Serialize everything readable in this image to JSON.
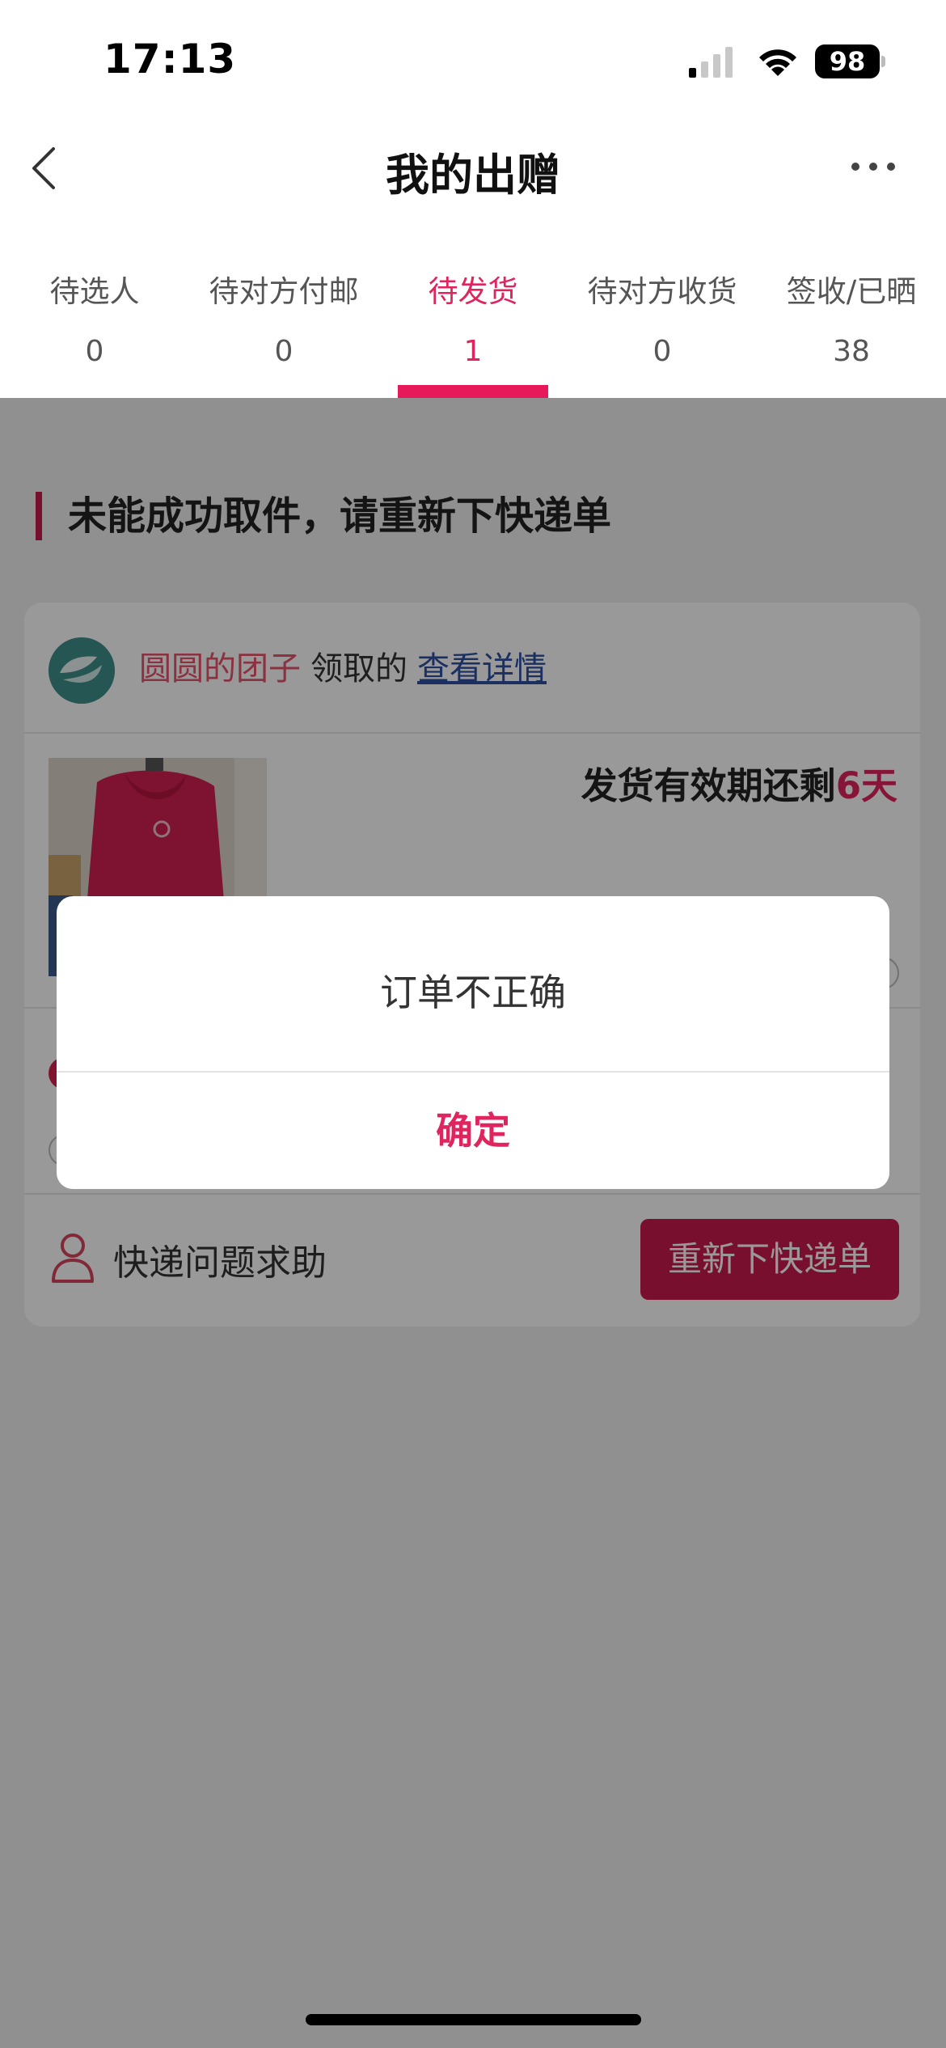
{
  "status_bar": {
    "time": "17:13",
    "battery": "98",
    "icons": [
      "signal-icon",
      "wifi-icon",
      "battery-icon"
    ]
  },
  "nav": {
    "title": "我的出赠",
    "back_icon": "chevron-left-icon",
    "more_icon": "more-horizontal-icon"
  },
  "tabs": [
    {
      "label": "待选人",
      "count": "0",
      "active": false
    },
    {
      "label": "待对方付邮",
      "count": "0",
      "active": false
    },
    {
      "label": "待发货",
      "count": "1",
      "active": true
    },
    {
      "label": "待对方收货",
      "count": "0",
      "active": false
    },
    {
      "label": "签收/已晒",
      "count": "38",
      "active": false
    }
  ],
  "section": {
    "title": "未能成功取件，请重新下快递单"
  },
  "card": {
    "user_name": "圆圆的团子",
    "claim_text": "领取的",
    "detail_link": "查看详情",
    "deadline_prefix": "发货有效期还剩",
    "deadline_days": "6天",
    "help_text": "快递问题求助",
    "reorder_button": "重新下快递单"
  },
  "dialog": {
    "message": "订单不正确",
    "confirm": "确定"
  },
  "colors": {
    "accent": "#e0245e",
    "button": "#c8194f",
    "user_name": "#e8536b",
    "link": "#2d4fa0"
  }
}
